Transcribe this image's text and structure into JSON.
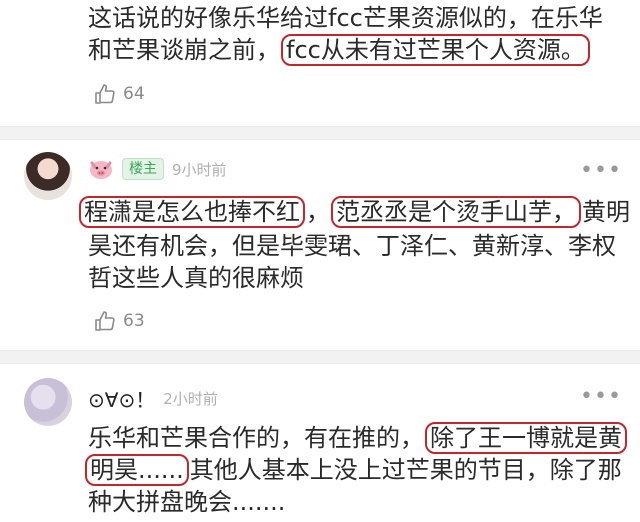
{
  "comment1": {
    "line1": "这话说的好像乐华给过fcc芒果资源似的，在乐华",
    "line2_plain": "和芒果谈崩之前，",
    "line2_highlight": "fcc从未有过芒果个人资源。",
    "likes": "64"
  },
  "comment2": {
    "username_icon": "pig-face-emoji",
    "badge": "楼主",
    "time": "9小时前",
    "line1_hl1": "程潇是怎么也捧不红",
    "line1_mid": "，",
    "line1_hl2": "范丞丞是个烫手山芋，",
    "line1_tail": "黄明",
    "line2": "昊还有机会，但是毕雯珺、丁泽仁、黄新淳、李权",
    "line3": "哲这些人真的很麻烦",
    "likes": "63"
  },
  "comment3": {
    "username": "⊙∀⊙！",
    "time": "2小时前",
    "line1_plain": "乐华和芒果合作的，有在推的，",
    "line1_hl": "除了王一博就是黄",
    "line2_hl": "明昊......",
    "line2_plain": "其他人基本上没上过芒果的节目，除了那",
    "line3": "种大拼盘晚会......."
  },
  "more_glyph": "•••",
  "colors": {
    "highlight_border": "#c1272d",
    "badge_green": "#3aa757",
    "muted": "#8a8a8a"
  }
}
